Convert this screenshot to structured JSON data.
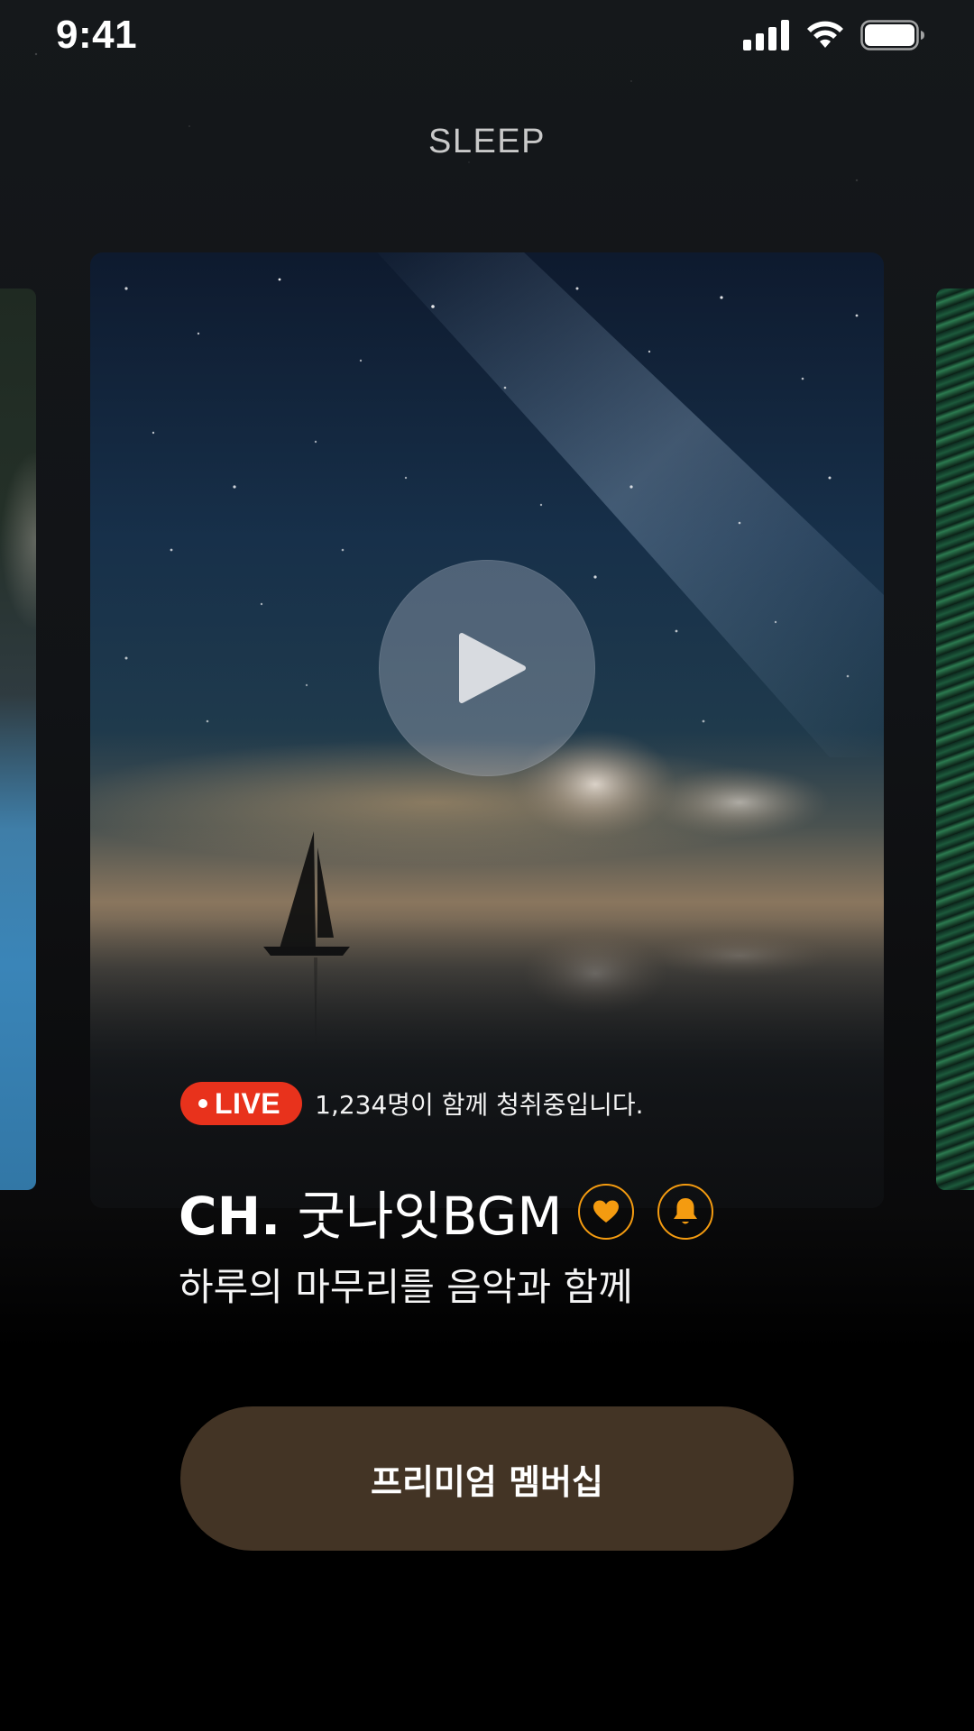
{
  "status_bar": {
    "time": "9:41",
    "icons": [
      "cellular-signal-icon",
      "wifi-icon",
      "battery-icon"
    ]
  },
  "header": {
    "title": "SLEEP"
  },
  "carousel": {
    "current": {
      "image": "starry-night-sailboat",
      "live_label": "LIVE",
      "listener_text": "1,234명이 함께 청취중입니다.",
      "channel_prefix": "CH.",
      "channel_name": "굿나잇BGM",
      "description": "하루의 마무리를 음악과 함께",
      "icons": [
        "play-icon",
        "heart-icon",
        "bell-icon"
      ]
    }
  },
  "cta": {
    "premium_label": "프리미엄 멤버십"
  },
  "colors": {
    "live_badge": "#e8321c",
    "accent": "#f49b10",
    "premium_button": "#433425",
    "background": "#000000"
  }
}
